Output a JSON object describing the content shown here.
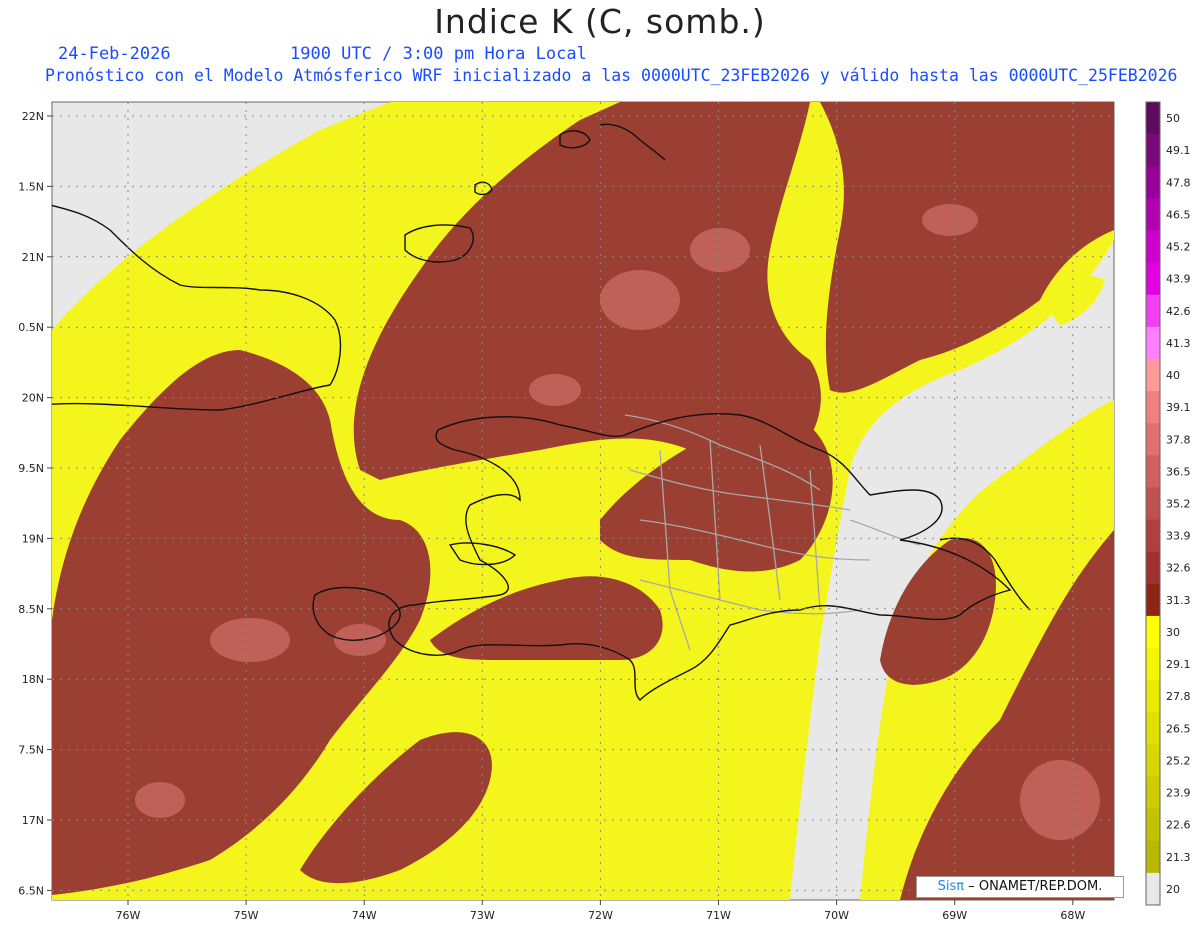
{
  "header": {
    "title": "Indice K (C, somb.)",
    "date": "24-Feb-2026",
    "time": "1900 UTC / 3:00 pm Hora Local",
    "forecast": "Pronóstico con el Modelo Atmósferico WRF inicializado a las 0000UTC_23FEB2026 y válido hasta las  0000UTC_25FEB2026"
  },
  "axes": {
    "lat_labels": [
      "22N",
      "1.5N",
      "21N",
      "0.5N",
      "20N",
      "9.5N",
      "19N",
      "8.5N",
      "18N",
      "7.5N",
      "17N",
      "6.5N"
    ],
    "lon_labels": [
      "76W",
      "75W",
      "74W",
      "73W",
      "72W",
      "71W",
      "70W",
      "69W",
      "68W"
    ]
  },
  "colorbar": {
    "labels": [
      "50",
      "49.1",
      "47.8",
      "46.5",
      "45.2",
      "43.9",
      "42.6",
      "41.3",
      "40",
      "39.1",
      "37.8",
      "36.5",
      "35.2",
      "33.9",
      "32.6",
      "31.3",
      "30",
      "29.1",
      "27.8",
      "26.5",
      "25.2",
      "23.9",
      "22.6",
      "21.3",
      "20"
    ],
    "colors": [
      "#5e0a5e",
      "#7a0a7a",
      "#990099",
      "#b000b0",
      "#cc00cc",
      "#e000e0",
      "#f23ff2",
      "#ff7fff",
      "#ff9a9a",
      "#f08080",
      "#e07070",
      "#d06060",
      "#bf5050",
      "#b04040",
      "#a03030",
      "#8e2414",
      "#ffff00",
      "#f5f500",
      "#eaea00",
      "#e0e000",
      "#d6d600",
      "#cccc00",
      "#c2c200",
      "#b8b800",
      "#e8e8e8"
    ]
  },
  "map_colors": {
    "background": "#e8e8e8",
    "k_low": "#f5f51e",
    "k_high": "#9b3f33",
    "k_peak": "#c86a63",
    "coast": "#111111",
    "province": "#a8a8a8"
  },
  "credit": {
    "sis": "Sisπ",
    "rest": "– ONAMET/REP.DOM."
  }
}
